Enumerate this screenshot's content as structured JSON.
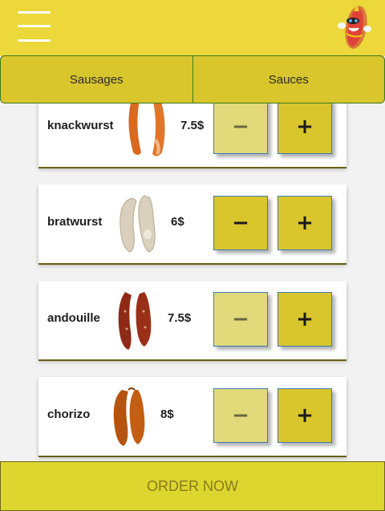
{
  "tabs": [
    {
      "label": "Sausages"
    },
    {
      "label": "Sauces"
    }
  ],
  "products": [
    {
      "name": "knackwurst",
      "price": "7.5$",
      "image_icon": "knackwurst-image",
      "minus_enabled": false
    },
    {
      "name": "bratwurst",
      "price": "6$",
      "image_icon": "bratwurst-image",
      "minus_enabled": true
    },
    {
      "name": "andouille",
      "price": "7.5$",
      "image_icon": "andouille-image",
      "minus_enabled": false
    },
    {
      "name": "chorizo",
      "price": "8$",
      "image_icon": "chorizo-image",
      "minus_enabled": false
    }
  ],
  "buttons": {
    "minus": "−",
    "plus": "+"
  },
  "order": {
    "label": "ORDER NOW"
  },
  "colors": {
    "header": "#ecd83a",
    "tab": "#d9c52c",
    "order": "#ddd62f"
  }
}
